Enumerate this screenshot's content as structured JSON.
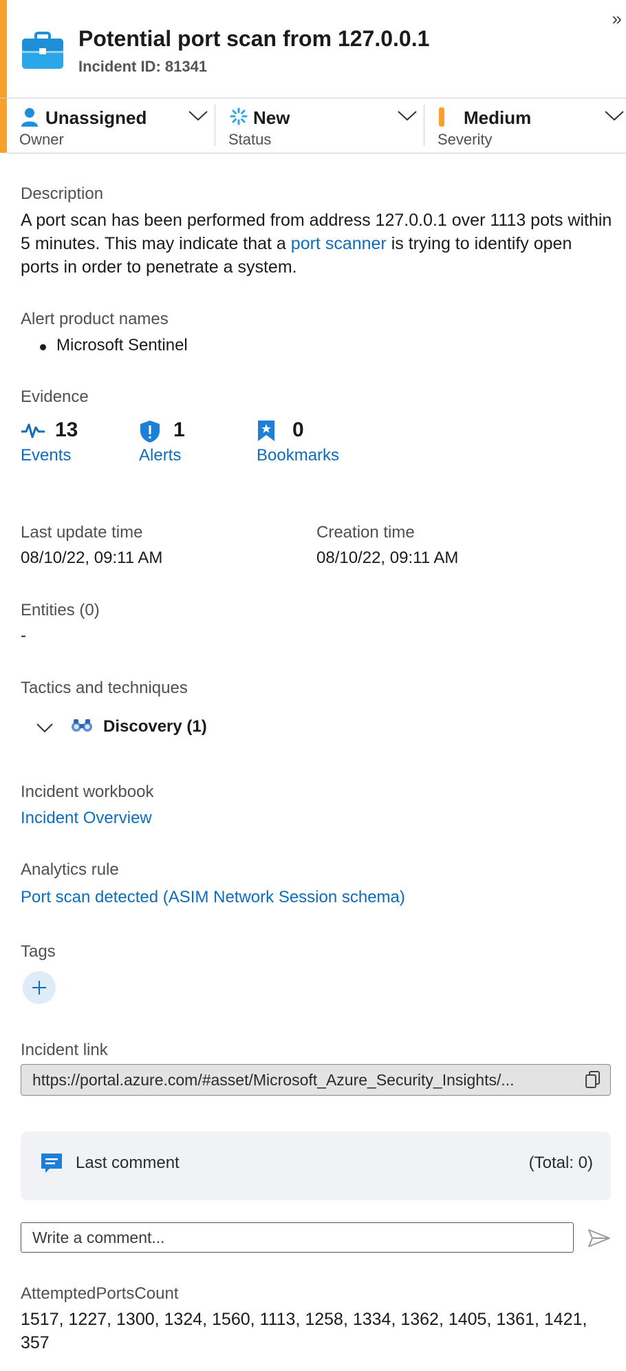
{
  "header": {
    "title": "Potential port scan from 127.0.0.1",
    "incident_id": "Incident ID: 81341",
    "accent_color": "#f7a02c"
  },
  "selectors": {
    "owner": {
      "value": "Unassigned",
      "label": "Owner"
    },
    "status": {
      "value": "New",
      "label": "Status"
    },
    "severity": {
      "value": "Medium",
      "label": "Severity",
      "color": "#f7a02c"
    }
  },
  "description": {
    "label": "Description",
    "text_before": "A port scan has been performed from address 127.0.0.1 over 1113 pots within 5 minutes. This may indicate that a ",
    "link_text": "port scanner",
    "text_after": " is trying to identify open ports in order to penetrate a system."
  },
  "alert_products": {
    "label": "Alert product names",
    "items": [
      "Microsoft Sentinel"
    ]
  },
  "evidence": {
    "label": "Evidence",
    "events": {
      "count": "13",
      "label": "Events",
      "icon": "activity-icon"
    },
    "alerts": {
      "count": "1",
      "label": "Alerts",
      "icon": "shield-alert-icon"
    },
    "bookmarks": {
      "count": "0",
      "label": "Bookmarks",
      "icon": "bookmark-icon"
    }
  },
  "times": {
    "last_update_label": "Last update time",
    "last_update_value": "08/10/22, 09:11 AM",
    "creation_label": "Creation time",
    "creation_value": "08/10/22, 09:11 AM"
  },
  "entities": {
    "label": "Entities (0)",
    "value": "-"
  },
  "tactics": {
    "label": "Tactics and techniques",
    "items": [
      {
        "name": "Discovery (1)",
        "icon": "binoculars-icon"
      }
    ]
  },
  "workbook": {
    "label": "Incident workbook",
    "link": "Incident Overview"
  },
  "analytics_rule": {
    "label": "Analytics rule",
    "link": "Port scan detected (ASIM Network Session schema)"
  },
  "tags": {
    "label": "Tags",
    "add_icon": "plus-icon"
  },
  "incident_link": {
    "label": "Incident link",
    "url": "https://portal.azure.com/#asset/Microsoft_Azure_Security_Insights/..."
  },
  "comments": {
    "panel_label": "Last comment",
    "total": "(Total: 0)",
    "placeholder": "Write a comment..."
  },
  "attempted_ports": {
    "label": "AttemptedPortsCount",
    "value": "1517, 1227, 1300, 1324, 1560, 1113, 1258, 1334, 1362, 1405, 1361, 1421, 357"
  }
}
